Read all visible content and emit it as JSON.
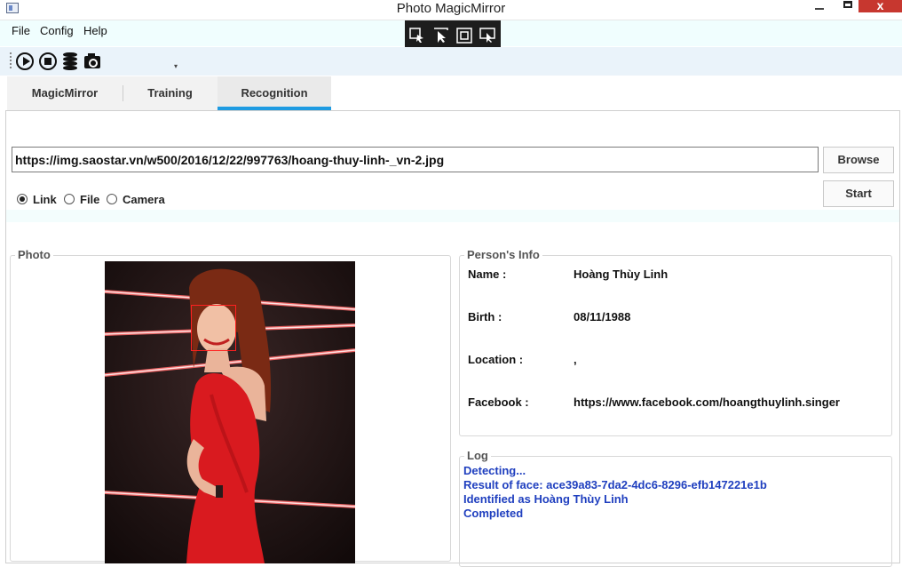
{
  "window": {
    "title": "Photo MagicMirror",
    "close_glyph": "x"
  },
  "menu": {
    "items": [
      "File",
      "Config",
      "Help"
    ]
  },
  "toolbar": {
    "icons": [
      "play-icon",
      "stop-icon",
      "database-icon",
      "camera-icon"
    ],
    "overflow_glyph": "▾"
  },
  "tabs": [
    {
      "label": "MagicMirror",
      "active": false
    },
    {
      "label": "Training",
      "active": false
    },
    {
      "label": "Recognition",
      "active": true
    }
  ],
  "source": {
    "url": "https://img.saostar.vn/w500/2016/12/22/997763/hoang-thuy-linh-_vn-2.jpg",
    "browse_label": "Browse",
    "start_label": "Start",
    "options": [
      "Link",
      "File",
      "Camera"
    ],
    "selected": "Link"
  },
  "photo": {
    "title": "Photo"
  },
  "person": {
    "title": "Person's Info",
    "fields": [
      {
        "label": "Name :",
        "value": "Hoàng Thùy Linh"
      },
      {
        "label": "Birth :",
        "value": "08/11/1988"
      },
      {
        "label": "Location :",
        "value": ","
      },
      {
        "label": "Facebook :",
        "value": "https://www.facebook.com/hoangthuylinh.singer"
      }
    ]
  },
  "log": {
    "title": "Log",
    "lines": [
      "Detecting...",
      "Result of face: ace39a83-7da2-4dc6-8296-efb147221e1b",
      "Identified as Hoàng Thùy Linh",
      "Completed"
    ]
  },
  "colors": {
    "accent": "#1e9be2",
    "log_text": "#1f3fbf",
    "face_box": "#ff2020",
    "close": "#c7372f"
  }
}
